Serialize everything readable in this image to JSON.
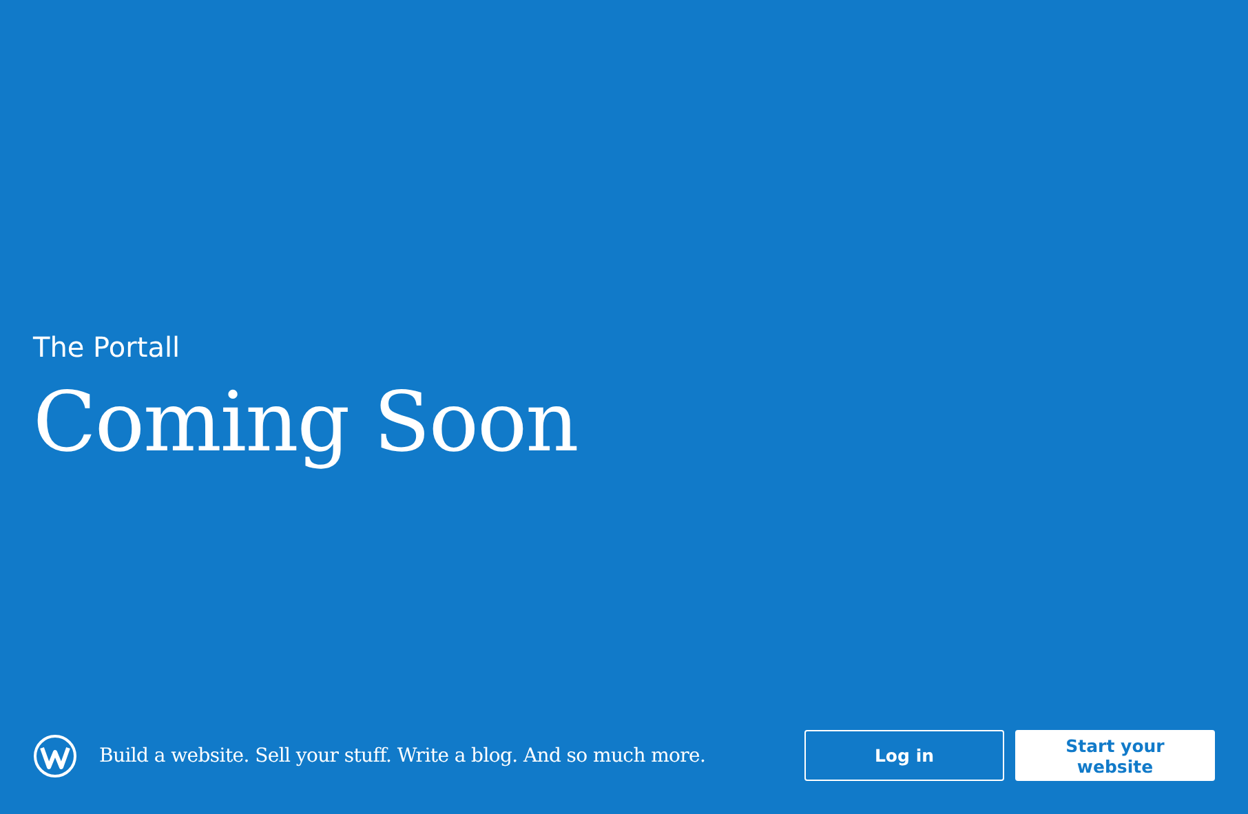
{
  "site_title": "The Portall",
  "heading": "Coming Soon",
  "footer": {
    "tagline": "Build a website. Sell your stuff. Write a blog. And so much more.",
    "buttons": [
      {
        "label": "Log in",
        "kind": "outline"
      },
      {
        "label": "Start your website",
        "kind": "solid"
      }
    ]
  }
}
